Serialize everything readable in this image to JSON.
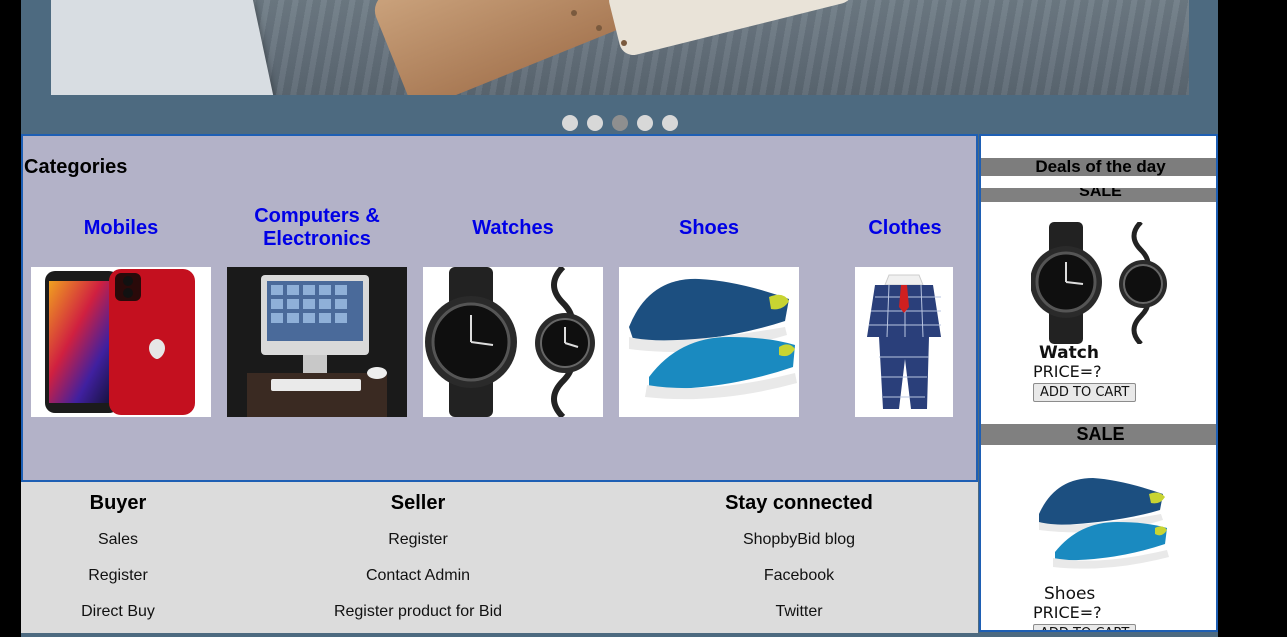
{
  "carousel": {
    "indicators": 5,
    "active_index": 2
  },
  "categories": {
    "title": "Categories",
    "items": [
      {
        "label": "Mobiles"
      },
      {
        "label": "Computers & Electronics"
      },
      {
        "label": "Watches"
      },
      {
        "label": "Shoes"
      },
      {
        "label": "Clothes"
      }
    ]
  },
  "deals": {
    "title": "Deals of the day",
    "top_sale_label": "SALE",
    "items": [
      {
        "name": "Watch",
        "price": "PRICE=?",
        "button": "ADD TO CART"
      },
      {
        "sale_label": "SALE",
        "name": "Shoes",
        "price": "PRICE=?",
        "button": "ADD TO CART"
      }
    ]
  },
  "footer": {
    "buyer": {
      "heading": "Buyer",
      "links": [
        "Sales",
        "Register",
        "Direct Buy"
      ]
    },
    "seller": {
      "heading": "Seller",
      "links": [
        "Register",
        "Contact Admin",
        "Register product for Bid"
      ]
    },
    "social": {
      "heading": "Stay connected",
      "links": [
        "ShopbyBid blog",
        "Facebook",
        "Twitter"
      ]
    }
  },
  "colors": {
    "link": "#0000e6",
    "panel": "#b3b2c8",
    "frame": "#4d6a80",
    "border": "#1e5fb4"
  }
}
